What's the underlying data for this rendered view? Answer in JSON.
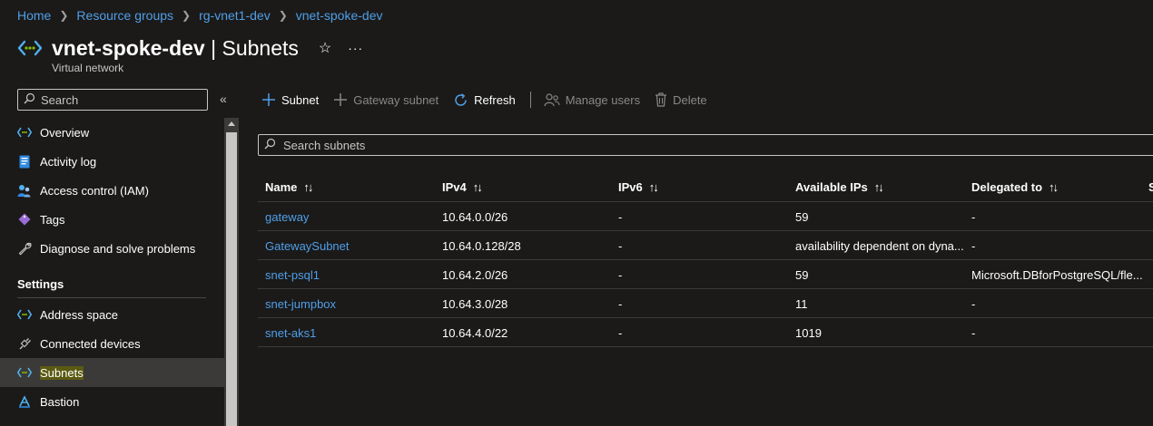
{
  "breadcrumb": [
    "Home",
    "Resource groups",
    "rg-vnet1-dev",
    "vnet-spoke-dev"
  ],
  "header": {
    "resource_name": "vnet-spoke-dev",
    "separator": " | ",
    "page": "Subnets",
    "subtitle": "Virtual network",
    "star_icon": "☆",
    "more_icon": "···"
  },
  "sidebar": {
    "search_placeholder": "Search",
    "collapse_icon": "«",
    "items": [
      {
        "label": "Overview",
        "icon": "vnet-icon"
      },
      {
        "label": "Activity log",
        "icon": "activity-log-icon"
      },
      {
        "label": "Access control (IAM)",
        "icon": "iam-icon"
      },
      {
        "label": "Tags",
        "icon": "tag-icon"
      },
      {
        "label": "Diagnose and solve problems",
        "icon": "wrench-icon"
      }
    ],
    "section": "Settings",
    "settings_items": [
      {
        "label": "Address space",
        "icon": "vnet-icon"
      },
      {
        "label": "Connected devices",
        "icon": "plug-icon"
      },
      {
        "label": "Subnets",
        "icon": "vnet-icon",
        "selected": true
      },
      {
        "label": "Bastion",
        "icon": "bastion-icon"
      }
    ]
  },
  "toolbar": {
    "subnet": "Subnet",
    "gateway_subnet": "Gateway subnet",
    "refresh": "Refresh",
    "manage_users": "Manage users",
    "delete": "Delete"
  },
  "search": {
    "placeholder": "Search subnets"
  },
  "table": {
    "columns": [
      "Name",
      "IPv4",
      "IPv6",
      "Available IPs",
      "Delegated to",
      "S"
    ],
    "rows": [
      [
        "gateway",
        "10.64.0.0/26",
        "-",
        "59",
        "-"
      ],
      [
        "GatewaySubnet",
        "10.64.0.128/28",
        "-",
        "availability dependent on dyna...",
        "-"
      ],
      [
        "snet-psql1",
        "10.64.2.0/26",
        "-",
        "59",
        "Microsoft.DBforPostgreSQL/fle..."
      ],
      [
        "snet-jumpbox",
        "10.64.3.0/28",
        "-",
        "11",
        "-"
      ],
      [
        "snet-aks1",
        "10.64.4.0/22",
        "-",
        "1019",
        "-"
      ]
    ]
  },
  "colors": {
    "link": "#4f9fe8",
    "background": "#1b1a19",
    "selected": "#3b3a39",
    "highlight": "#5b5a12"
  }
}
